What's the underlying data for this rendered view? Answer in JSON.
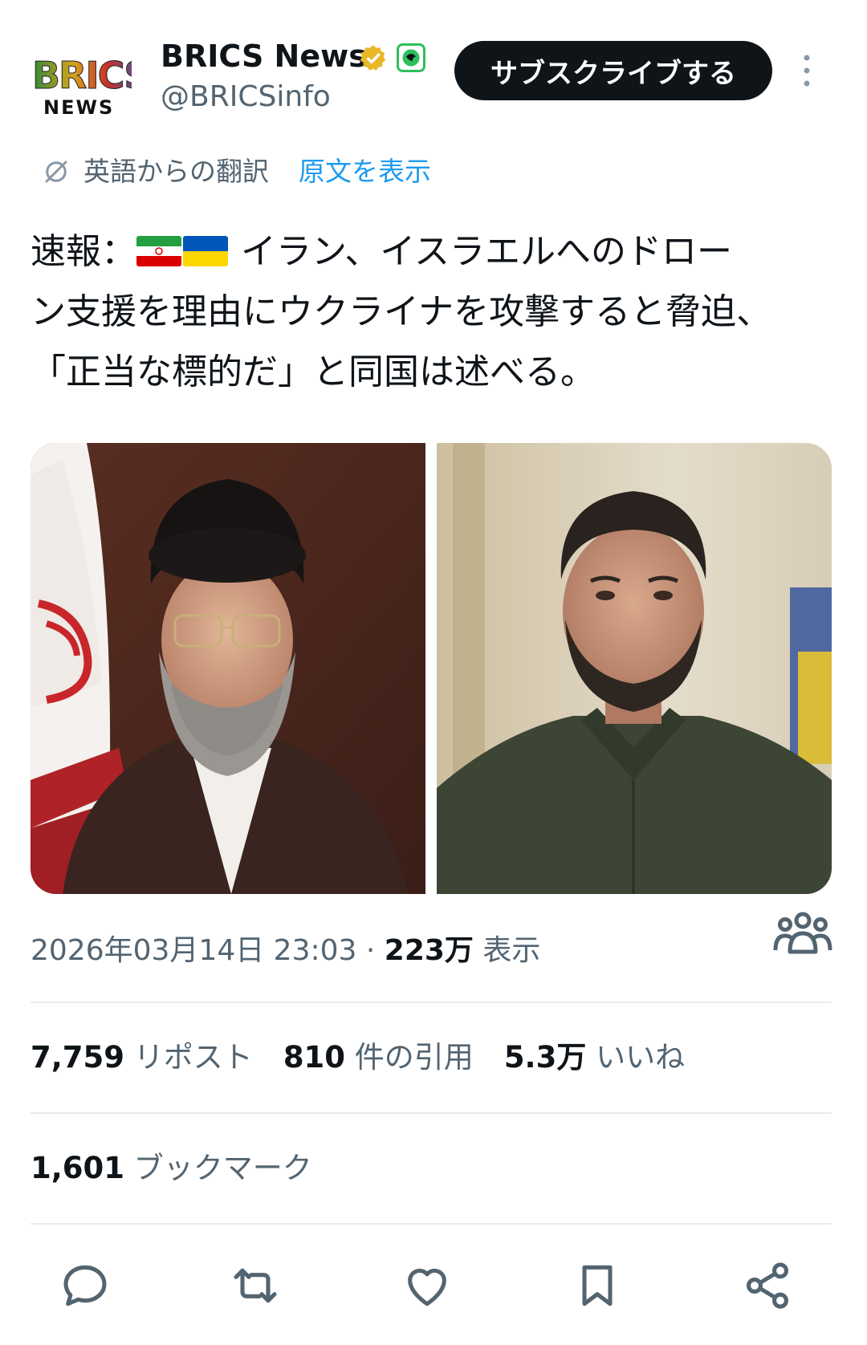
{
  "header": {
    "avatar_top": "BRICS",
    "avatar_bottom": "NEWS",
    "name": "BRICS News",
    "handle": "@BRICSinfo",
    "subscribe_label": "サブスクライブする"
  },
  "translation": {
    "label": "英語からの翻訳",
    "link": "原文を表示"
  },
  "tweet": {
    "line1_prefix": "速報：",
    "flags": [
      "Iran flag",
      "Ukraine flag"
    ],
    "line1_rest": " イラン、イスラエルへのドロー",
    "line2": "ン支援を理由にウクライナを攻撃すると脅迫、",
    "line3": "「正当な標的だ」と同国は述べる。"
  },
  "media": {
    "left": "Iranian cleric portrait with Iran flag",
    "right": "Zelensky portrait"
  },
  "meta": {
    "datetime": "2026年03月14日 23:03",
    "separator": " · ",
    "views": "223万",
    "views_label": " 表示"
  },
  "stats": {
    "reposts": "7,759",
    "reposts_label": " リポスト",
    "quotes": "810",
    "quotes_label": " 件の引用",
    "likes": "5.3万",
    "likes_label": " いいね",
    "bookmarks": "1,601",
    "bookmarks_label": " ブックマーク"
  },
  "icons": {
    "verified": "verified-badge-icon",
    "affiliation": "affiliation-badge-icon",
    "more": "more-vertical-icon",
    "translate": "translate-icon",
    "community": "community-icon",
    "reply": "reply-icon",
    "repost": "repost-icon",
    "like": "like-icon",
    "bookmark": "bookmark-icon",
    "share": "share-icon"
  },
  "colors": {
    "text": "#0f1419",
    "secondary": "#536471",
    "link": "#1d9bf0",
    "button": "#0f1419",
    "verified": "#e8b828",
    "affiliation": "#2fbf5e"
  }
}
